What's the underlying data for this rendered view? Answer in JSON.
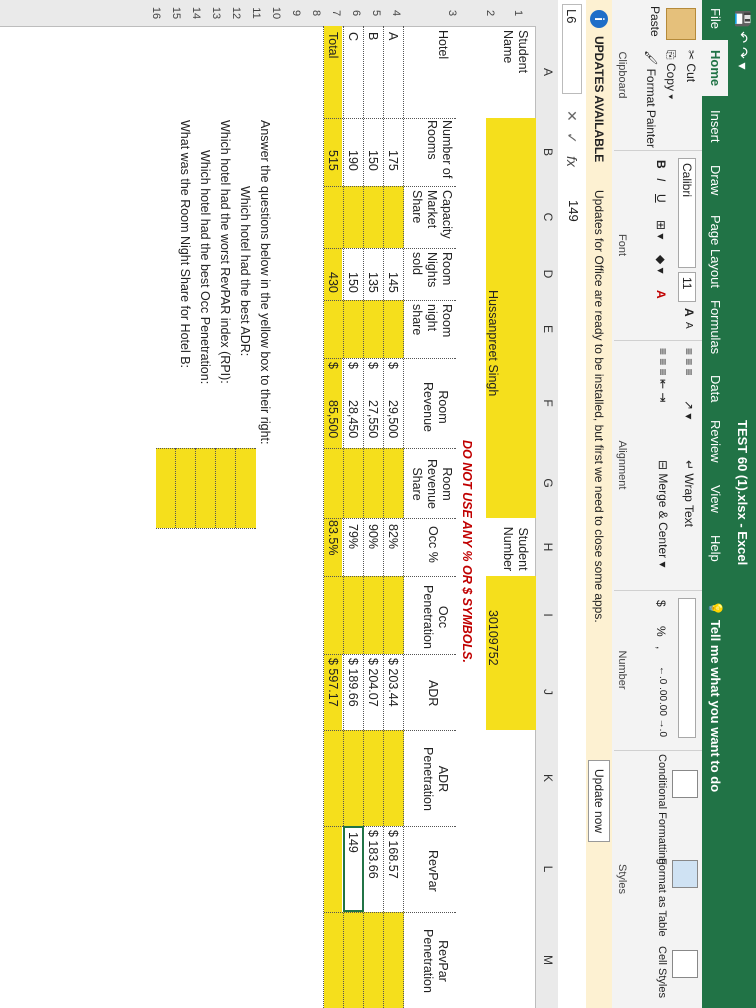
{
  "app": {
    "window_title": "TEST 60 (1).xlsx  -  Excel",
    "tabs": [
      "File",
      "Home",
      "Insert",
      "Draw",
      "Page Layout",
      "Formulas",
      "Data",
      "Review",
      "View",
      "Help"
    ],
    "tell_me": "Tell me what you want to do"
  },
  "ribbon": {
    "clipboard": {
      "paste": "Paste",
      "cut": "Cut",
      "copy": "Copy",
      "format_painter": "Format Painter",
      "label": "Clipboard"
    },
    "font": {
      "name": "Calibri",
      "size": "11",
      "bold": "B",
      "italic": "I",
      "underline": "U",
      "grow": "A",
      "shrink": "A",
      "font_color": "A",
      "label": "Font"
    },
    "alignment": {
      "wrap_text": "Wrap Text",
      "merge_center": "Merge & Center",
      "label": "Alignment"
    },
    "number": {
      "currency": "$",
      "percent": "%",
      "comma": ",",
      "inc_dec": "←.0 .00",
      "dec_dec": ".00 →.0",
      "label": "Number"
    },
    "styles": {
      "conditional": "Conditional Formatting",
      "format_as_table": "Format as Table",
      "cell_styles": "Cell Styles",
      "label": "Styles"
    }
  },
  "message_bar": {
    "title": "UPDATES AVAILABLE",
    "text": "Updates for Office are ready to be installed, but first we need to close some apps.",
    "button": "Update now"
  },
  "formula_bar": {
    "name_box": "L6",
    "formula": "149",
    "fx": "fx",
    "cancel": "✕",
    "enter": "✓"
  },
  "columns": [
    "A",
    "B",
    "C",
    "D",
    "E",
    "F",
    "G",
    "H",
    "I",
    "J",
    "K",
    "L",
    "M"
  ],
  "rows": [
    "1",
    "2",
    "3",
    "4",
    "5",
    "6",
    "7",
    "8",
    "9",
    "10",
    "11",
    "12",
    "13",
    "14",
    "15",
    "16"
  ],
  "sheet": {
    "student_name_label": "Student Name",
    "student_name": "Hussanpreet Singh",
    "student_number_label": "Student Number",
    "student_number": "30109752",
    "warning": "DO NOT USE ANY % OR $ SYMBOLS.",
    "headers": {
      "hotel": "Hotel",
      "rooms": "Number of Rooms",
      "capacity": "Capacity Market Share",
      "nights_sold": "Room Nights sold",
      "night_share": "Room night share",
      "revenue": "Room Revenue",
      "revenue_share": "Room Revenue Share",
      "occ": "Occ %",
      "occ_pen": "Occ Penetration",
      "adr": "ADR",
      "adr_pen": "ADR Penetration",
      "revpar": "RevPar",
      "revpar_pen": "RevPar Penetration"
    },
    "data": [
      {
        "hotel": "A",
        "rooms": "175",
        "nights": "145",
        "revenue": "29,500",
        "rev_share": "",
        "occ": "82%",
        "adr": "$ 203.44",
        "revpar": "$    168.57",
        "revpar_pen": ""
      },
      {
        "hotel": "B",
        "rooms": "150",
        "nights": "135",
        "revenue": "27,550",
        "rev_share": "",
        "occ": "90%",
        "adr": "$ 204.07",
        "revpar": "$    183.66",
        "revpar_pen": ""
      },
      {
        "hotel": "C",
        "rooms": "190",
        "nights": "150",
        "revenue": "28,450",
        "rev_share": "",
        "occ": "79%",
        "adr": "$ 189.66",
        "revpar": "149",
        "revpar_pen": ""
      }
    ],
    "total": {
      "label": "Total",
      "rooms": "515",
      "nights": "430",
      "revenue": "85,500",
      "occ": "83.5%",
      "adr": "$ 597.17"
    },
    "dollar": "$",
    "questions": [
      "Answer the questions below in the yellow box to their right:",
      "Which hotel had the best ADR:",
      "Which hotel had the worst RevPAR index (RPI):",
      "Which hotel had the best Occ Penetration:",
      "What was the Room Night Share for Hotel B:"
    ]
  }
}
